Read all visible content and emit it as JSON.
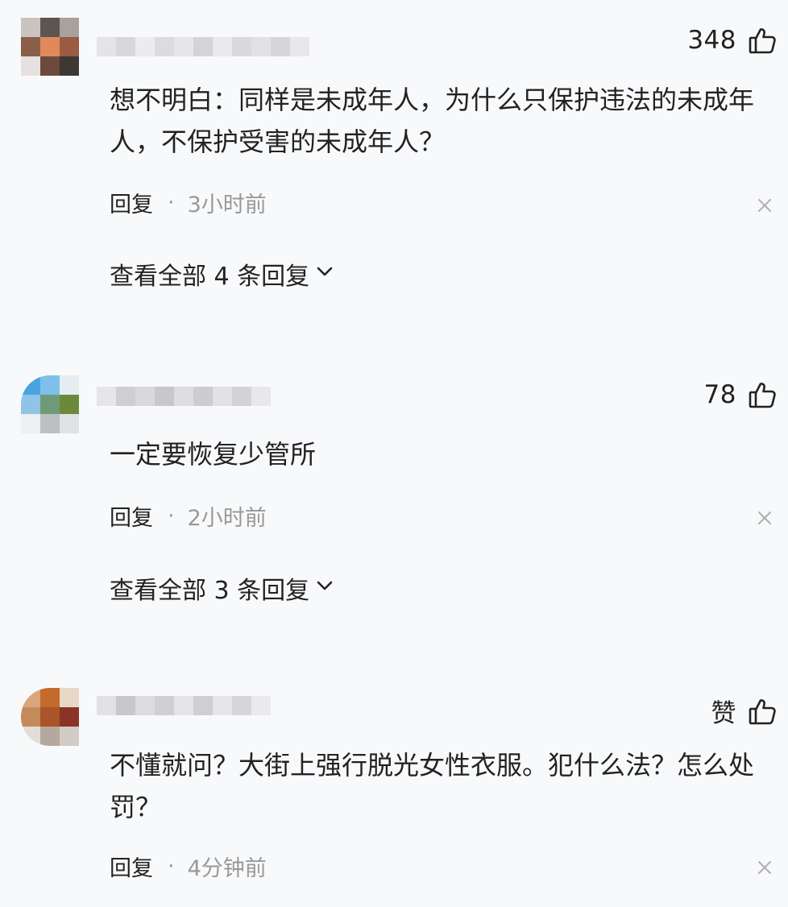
{
  "comments": [
    {
      "likes": "348",
      "text": "想不明白：同样是未成年人，为什么只保护违法的未成年人，不保护受害的未成年人？",
      "reply_label": "回复",
      "separator": "·",
      "time": "3小时前",
      "view_replies": "查看全部 4 条回复"
    },
    {
      "likes": "78",
      "text": "一定要恢复少管所",
      "reply_label": "回复",
      "separator": "·",
      "time": "2小时前",
      "view_replies": "查看全部 3 条回复"
    },
    {
      "likes": "赞",
      "text": "不懂就问？大街上强行脱光女性衣服。犯什么法？怎么处罚？",
      "reply_label": "回复",
      "separator": "·",
      "time": "4分钟前"
    }
  ],
  "icons": {
    "like": "thumbs-up-icon",
    "close": "close-icon",
    "expand": "chevron-down-icon"
  },
  "colors": {
    "background": "#f8f9fb",
    "text": "#222222",
    "meta_text": "#999999"
  }
}
